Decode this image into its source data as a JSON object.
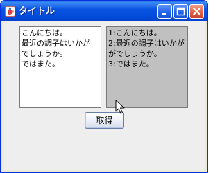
{
  "window": {
    "title": "タイトル",
    "icon": "java-cup-icon",
    "controls": [
      "minimize-icon",
      "maximize-icon",
      "close-icon"
    ]
  },
  "left_textarea": {
    "text": "こんにちは。\n最近の調子はいかが\nでしょうか。\nではまた。"
  },
  "right_textarea": {
    "text": "1:こんにちは。\n2:最近の調子はいかが\nがでしょうか。\n3:ではまた。"
  },
  "fetch_button": {
    "label": "取得"
  },
  "colors": {
    "titlebar": "#0b55e3",
    "close_button": "#e26447",
    "client_bg": "#eeeeee",
    "disabled_area_bg": "#c0c0c0"
  }
}
